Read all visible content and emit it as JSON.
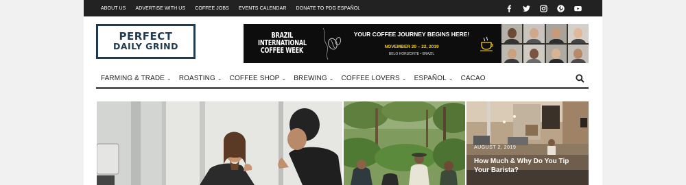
{
  "top_nav": [
    "ABOUT US",
    "ADVERTISE WITH US",
    "COFFEE JOBS",
    "EVENTS CALENDAR",
    "DONATE TO PDG ESPAÑOL"
  ],
  "social_icons": [
    "facebook-icon",
    "twitter-icon",
    "instagram-icon",
    "pinterest-icon",
    "youtube-icon"
  ],
  "logo": {
    "line1": "PERFECT",
    "line2": "DAILY GRIND"
  },
  "banner": {
    "event_lines": [
      "BRAZIL",
      "INTERNATIONAL",
      "COFFEE WEEK"
    ],
    "headline": "YOUR COFFEE JOURNEY BEGINS HERE!",
    "dates": "NOVEMBER 20 – 22, 2019",
    "location": "BELO HORIZONTE • BRAZIL"
  },
  "categories": [
    {
      "label": "FARMING & TRADE",
      "has_dropdown": true
    },
    {
      "label": "ROASTING",
      "has_dropdown": true
    },
    {
      "label": "COFFEE SHOP",
      "has_dropdown": true
    },
    {
      "label": "BREWING",
      "has_dropdown": true
    },
    {
      "label": "COFFEE LOVERS",
      "has_dropdown": true
    },
    {
      "label": "ESPAÑOL",
      "has_dropdown": true
    },
    {
      "label": "CACAO",
      "has_dropdown": false
    }
  ],
  "features": [
    {
      "image": "baristas-talking"
    },
    {
      "image": "coffee-farm-visit"
    },
    {
      "image": "cafe-interior",
      "date": "AUGUST 2, 2019",
      "title": "How Much & Why Do You Tip Your Barista?"
    }
  ],
  "colors": {
    "topbar": "#222222",
    "logo": "#1e3a50",
    "banner_bg": "#0d0d0d",
    "banner_date": "#ffd400",
    "nav_underline": "#555555"
  }
}
